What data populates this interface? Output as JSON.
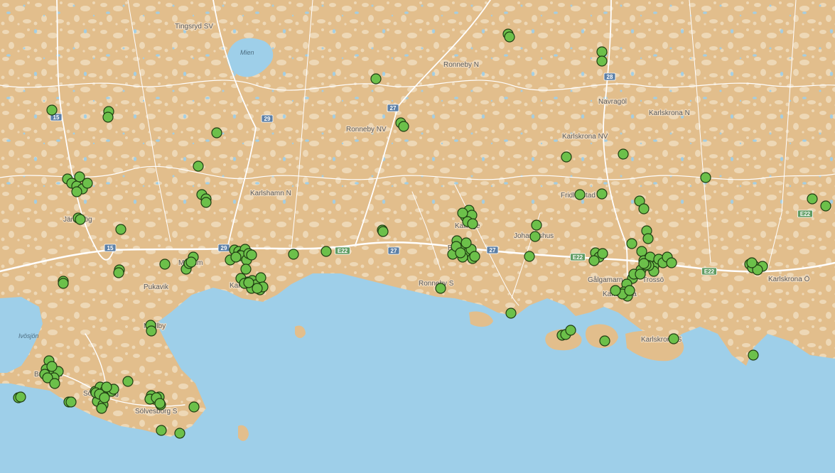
{
  "map": {
    "colors": {
      "water": "#9ecfe9",
      "land": "#e2be8c",
      "land_light": "#eed8b6",
      "road": "#ffffff",
      "marker_fill": "#6cc04a",
      "marker_stroke": "#1f3d12",
      "shield_blue": "#5b7fa6",
      "shield_green": "#5f9c63"
    },
    "places": [
      {
        "name": "Tingsryd SV"
      },
      {
        "name": "Ronneby N"
      },
      {
        "name": "Navragöl"
      },
      {
        "name": "Karlskrona N"
      },
      {
        "name": "Ronneby NV"
      },
      {
        "name": "Karlskrona NV"
      },
      {
        "name": "Karlshamn N"
      },
      {
        "name": "Fridlevstad"
      },
      {
        "name": "Jämshög"
      },
      {
        "name": "Kallinge"
      },
      {
        "name": "Johannishus"
      },
      {
        "name": "Mörrum"
      },
      {
        "name": "Ronneby"
      },
      {
        "name": "Gålgamarn"
      },
      {
        "name": "Trossö"
      },
      {
        "name": "Karlskrona Ö"
      },
      {
        "name": "Pukavik"
      },
      {
        "name": "Karlshamn"
      },
      {
        "name": "Ronneby S"
      },
      {
        "name": "Karlskrona"
      },
      {
        "name": "Karlskrona S"
      },
      {
        "name": "Mjällby"
      },
      {
        "name": "Bromölla"
      },
      {
        "name": "Sölvesborg"
      },
      {
        "name": "Sölvesborg S"
      }
    ],
    "water_names": [
      {
        "name": "Mien"
      },
      {
        "name": "Ivösjön"
      }
    ],
    "road_shields": [
      {
        "label": "15",
        "kind": "national"
      },
      {
        "label": "29",
        "kind": "national"
      },
      {
        "label": "27",
        "kind": "national"
      },
      {
        "label": "28",
        "kind": "national"
      },
      {
        "label": "15",
        "kind": "national"
      },
      {
        "label": "29",
        "kind": "national"
      },
      {
        "label": "27",
        "kind": "national"
      },
      {
        "label": "27",
        "kind": "national"
      },
      {
        "label": "E22",
        "kind": "european"
      },
      {
        "label": "E22",
        "kind": "european"
      },
      {
        "label": "E22",
        "kind": "european"
      },
      {
        "label": "E22",
        "kind": "european"
      }
    ],
    "markers": [
      {
        "name": "Tingsryd SV"
      },
      {
        "name": "Tingsryd SV"
      },
      {
        "name": "Ronneby N"
      },
      {
        "name": "Ronneby N"
      },
      {
        "name": "Ronneby N"
      },
      {
        "name": "Navragöl"
      },
      {
        "name": "Navragöl"
      },
      {
        "name": "Ronneby NV"
      },
      {
        "name": "Ronneby NV"
      },
      {
        "name": "Karlshamn N"
      },
      {
        "name": "Karlshamn N"
      },
      {
        "name": "Karlshamn N"
      },
      {
        "name": "Karlshamn N"
      },
      {
        "name": "Karlshamn N"
      },
      {
        "name": "Karlshamn N"
      },
      {
        "name": "Jämshög"
      },
      {
        "name": "Jämshög"
      },
      {
        "name": "Jämshög"
      },
      {
        "name": "Jämshög"
      },
      {
        "name": "Jämshög"
      },
      {
        "name": "Jämshög"
      },
      {
        "name": "Jämshög"
      },
      {
        "name": "Jämshög"
      },
      {
        "name": "Jämshög"
      },
      {
        "name": "Jämshög"
      },
      {
        "name": "Karlskrona NV"
      },
      {
        "name": "Karlskrona NV"
      },
      {
        "name": "Karlskrona N"
      },
      {
        "name": "Fridlevstad"
      },
      {
        "name": "Fridlevstad"
      },
      {
        "name": "Fridlevstad"
      },
      {
        "name": "Fridlevstad"
      },
      {
        "name": "Karlskrona Ö"
      },
      {
        "name": "Karlskrona Ö"
      },
      {
        "name": "Karlskrona Ö"
      },
      {
        "name": "Kallinge"
      },
      {
        "name": "Kallinge"
      },
      {
        "name": "Kallinge"
      },
      {
        "name": "Kallinge"
      },
      {
        "name": "Kallinge"
      },
      {
        "name": "Kallinge"
      },
      {
        "name": "Johannishus"
      },
      {
        "name": "Johannishus"
      },
      {
        "name": "Johannishus"
      },
      {
        "name": "Ronneby"
      },
      {
        "name": "Ronneby"
      },
      {
        "name": "Ronneby"
      },
      {
        "name": "Ronneby"
      },
      {
        "name": "Ronneby"
      },
      {
        "name": "Ronneby"
      },
      {
        "name": "Ronneby"
      },
      {
        "name": "Ronneby"
      },
      {
        "name": "Ronneby"
      },
      {
        "name": "Ronneby"
      },
      {
        "name": "Ronneby"
      },
      {
        "name": "Ronneby S"
      },
      {
        "name": "Ronneby S"
      },
      {
        "name": "Karlshamn"
      },
      {
        "name": "Karlshamn"
      },
      {
        "name": "Karlshamn"
      },
      {
        "name": "Karlshamn"
      },
      {
        "name": "Karlshamn"
      },
      {
        "name": "Karlshamn"
      },
      {
        "name": "Karlshamn"
      },
      {
        "name": "Karlshamn"
      },
      {
        "name": "Karlshamn"
      },
      {
        "name": "Karlshamn"
      },
      {
        "name": "Karlshamn"
      },
      {
        "name": "Karlshamn"
      },
      {
        "name": "Karlshamn"
      },
      {
        "name": "Karlshamn"
      },
      {
        "name": "Karlshamn"
      },
      {
        "name": "Karlshamn"
      },
      {
        "name": "Karlshamn"
      },
      {
        "name": "Karlshamn"
      },
      {
        "name": "Karlshamn"
      },
      {
        "name": "Karlshamn"
      },
      {
        "name": "Mörrum"
      },
      {
        "name": "Mörrum"
      },
      {
        "name": "Mörrum"
      },
      {
        "name": "Mörrum"
      },
      {
        "name": "Mörrum"
      },
      {
        "name": "Pukavik"
      },
      {
        "name": "Pukavik"
      },
      {
        "name": "Pukavik"
      },
      {
        "name": "Pukavik"
      },
      {
        "name": "Mjällby"
      },
      {
        "name": "Mjällby"
      },
      {
        "name": "Karlshamn"
      },
      {
        "name": "Karlshamn"
      },
      {
        "name": "Karlshamn"
      },
      {
        "name": "Karlshamn"
      },
      {
        "name": "Karlshamn"
      },
      {
        "name": "Karlshamn"
      },
      {
        "name": "Karlskrona"
      },
      {
        "name": "Karlskrona"
      },
      {
        "name": "Karlskrona"
      },
      {
        "name": "Karlskrona"
      },
      {
        "name": "Karlskrona"
      },
      {
        "name": "Karlskrona"
      },
      {
        "name": "Karlskrona"
      },
      {
        "name": "Karlskrona"
      },
      {
        "name": "Karlskrona"
      },
      {
        "name": "Karlskrona"
      },
      {
        "name": "Karlskrona"
      },
      {
        "name": "Karlskrona"
      },
      {
        "name": "Karlskrona"
      },
      {
        "name": "Karlskrona"
      },
      {
        "name": "Karlskrona"
      },
      {
        "name": "Karlskrona"
      },
      {
        "name": "Karlskrona"
      },
      {
        "name": "Karlskrona"
      },
      {
        "name": "Trossö"
      },
      {
        "name": "Trossö"
      },
      {
        "name": "Trossö"
      },
      {
        "name": "Trossö"
      },
      {
        "name": "Trossö"
      },
      {
        "name": "Trossö"
      },
      {
        "name": "Trossö"
      },
      {
        "name": "Trossö"
      },
      {
        "name": "Trossö"
      },
      {
        "name": "Trossö"
      },
      {
        "name": "Trossö"
      },
      {
        "name": "Trossö"
      },
      {
        "name": "Trossö"
      },
      {
        "name": "Gålgamarn"
      },
      {
        "name": "Gålgamarn"
      },
      {
        "name": "Gålgamarn"
      },
      {
        "name": "Gålgamarn"
      },
      {
        "name": "Gålgamarn"
      },
      {
        "name": "Karlskrona S"
      },
      {
        "name": "Karlskrona S"
      },
      {
        "name": "Karlskrona S"
      },
      {
        "name": "Karlskrona S"
      },
      {
        "name": "Karlskrona S"
      },
      {
        "name": "Karlskrona S"
      },
      {
        "name": "Karlskrona S"
      },
      {
        "name": "Bromölla"
      },
      {
        "name": "Bromölla"
      },
      {
        "name": "Bromölla"
      },
      {
        "name": "Bromölla"
      },
      {
        "name": "Bromölla"
      },
      {
        "name": "Bromölla"
      },
      {
        "name": "Bromölla"
      },
      {
        "name": "Bromölla"
      },
      {
        "name": "Bromölla"
      },
      {
        "name": "Bromölla"
      },
      {
        "name": "Bromölla"
      },
      {
        "name": "Bromölla"
      },
      {
        "name": "Sölvesborg"
      },
      {
        "name": "Sölvesborg"
      },
      {
        "name": "Sölvesborg"
      },
      {
        "name": "Sölvesborg"
      },
      {
        "name": "Sölvesborg"
      },
      {
        "name": "Sölvesborg"
      },
      {
        "name": "Sölvesborg"
      },
      {
        "name": "Sölvesborg"
      },
      {
        "name": "Sölvesborg"
      },
      {
        "name": "Sölvesborg"
      },
      {
        "name": "Sölvesborg"
      },
      {
        "name": "Sölvesborg"
      },
      {
        "name": "Sölvesborg"
      },
      {
        "name": "Sölvesborg"
      },
      {
        "name": "Sölvesborg S"
      },
      {
        "name": "Sölvesborg S"
      },
      {
        "name": "Sölvesborg S"
      },
      {
        "name": "Sölvesborg S"
      },
      {
        "name": "Sölvesborg S"
      },
      {
        "name": "Sölvesborg S"
      },
      {
        "name": "Sölvesborg S"
      },
      {
        "name": "Sölvesborg S"
      },
      {
        "name": "Sölvesborg S"
      },
      {
        "name": "Sölvesborg S"
      },
      {
        "name": "Sölvesborg S"
      },
      {
        "name": "Sölvesborg S"
      }
    ]
  }
}
